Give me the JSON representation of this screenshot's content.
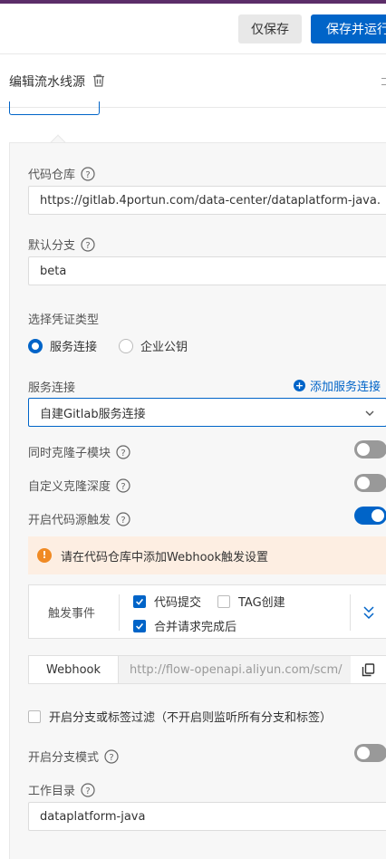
{
  "toolbar": {
    "save_only_label": "仅保存",
    "save_and_run_label": "保存并运行"
  },
  "panel": {
    "title": "编辑流水线源"
  },
  "form": {
    "repo": {
      "label": "代码仓库",
      "value": "https://gitlab.4portun.com/data-center/dataplatform-java."
    },
    "branch": {
      "label": "默认分支",
      "value": "beta"
    },
    "credential": {
      "label": "选择凭证类型",
      "options": [
        {
          "label": "服务连接",
          "selected": true
        },
        {
          "label": "企业公钥",
          "selected": false
        }
      ]
    },
    "service_connection": {
      "label": "服务连接",
      "add_link": "添加服务连接",
      "value": "自建Gitlab服务连接"
    },
    "clone_submodules": {
      "label": "同时克隆子模块",
      "enabled": false
    },
    "custom_clone_depth": {
      "label": "自定义克隆深度",
      "enabled": false
    },
    "source_trigger": {
      "label": "开启代码源触发",
      "enabled": true
    },
    "webhook_warning": "请在代码仓库中添加Webhook触发设置",
    "trigger_events": {
      "label": "触发事件",
      "events": [
        {
          "label": "代码提交",
          "checked": true
        },
        {
          "label": "TAG创建",
          "checked": false
        },
        {
          "label": "合并请求完成后",
          "checked": true
        }
      ]
    },
    "webhook": {
      "label": "Webhook",
      "url": "http://flow-openapi.aliyun.com/scm/"
    },
    "branch_filter": {
      "label": "开启分支或标签过滤（不开启则监听所有分支和标签）",
      "checked": false
    },
    "branch_mode": {
      "label": "开启分支模式",
      "enabled": false
    },
    "work_dir": {
      "label": "工作目录",
      "value": "dataplatform-java"
    }
  },
  "colors": {
    "primary": "#0064c8",
    "warning_bg": "#fdeee2",
    "warning_icon": "#f08a24",
    "top_accent": "#5c2d69"
  }
}
